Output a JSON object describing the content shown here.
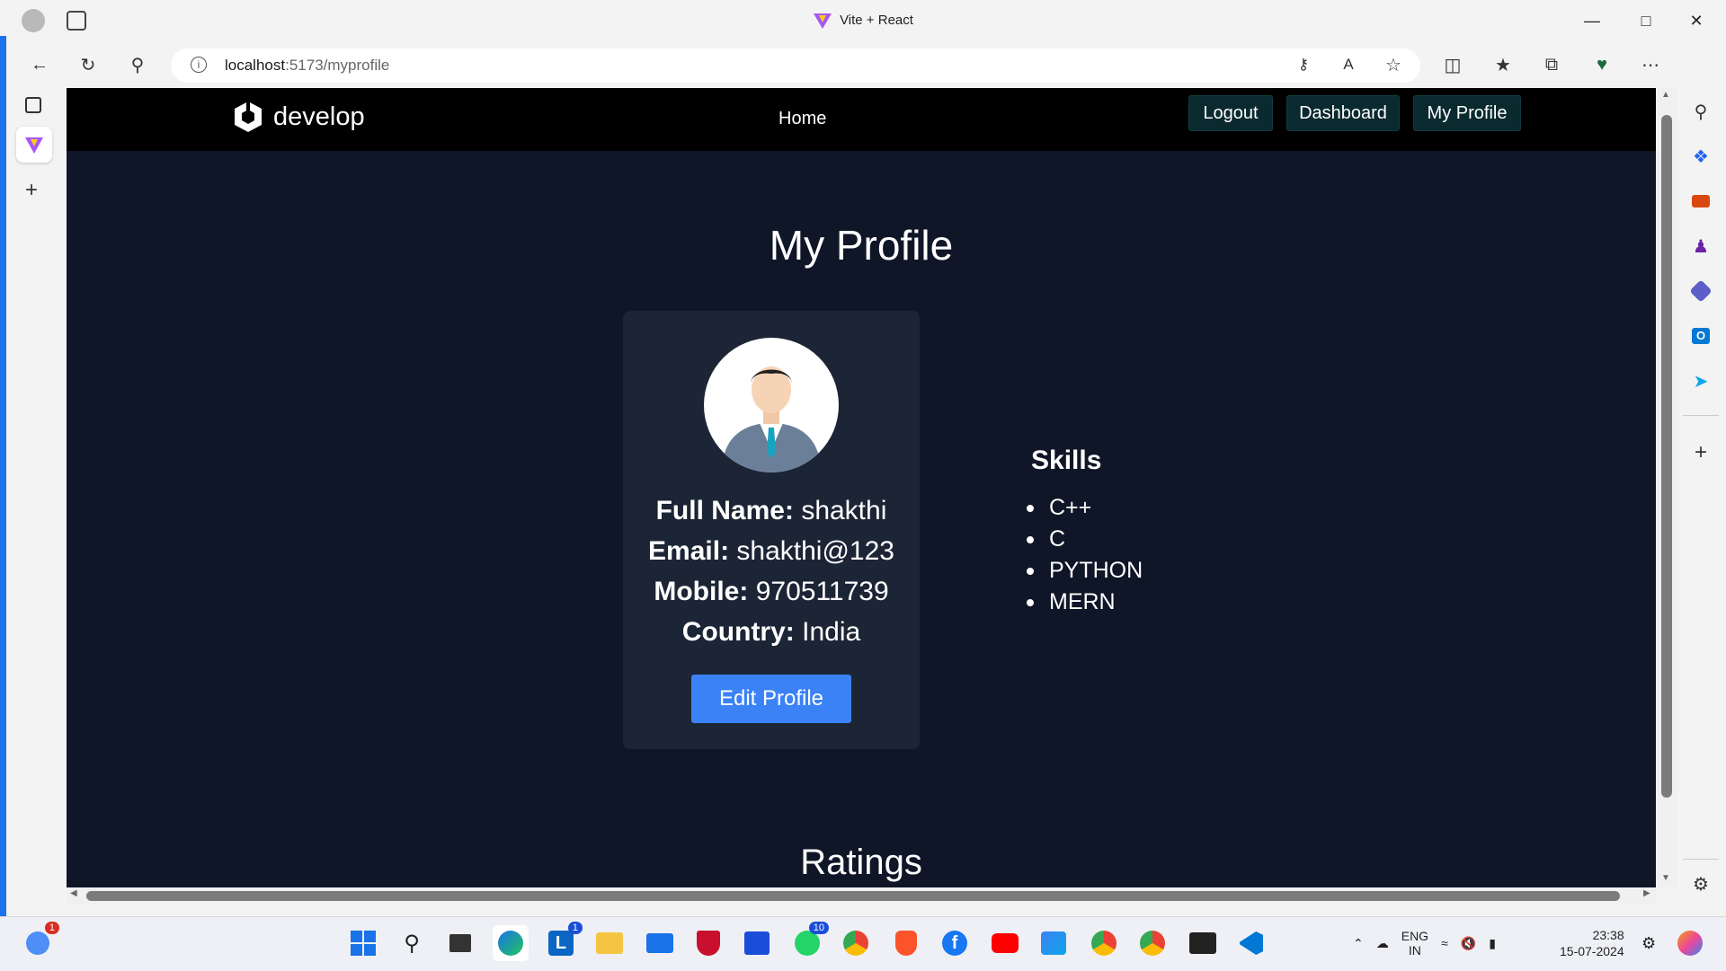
{
  "browser": {
    "tab_title": "Vite + React",
    "url_host": "localhost",
    "url_rest": ":5173/myprofile"
  },
  "nav": {
    "logo_text": "develop",
    "home": "Home",
    "logout": "Logout",
    "dashboard": "Dashboard",
    "my_profile": "My Profile"
  },
  "page": {
    "title": "My Profile",
    "ratings_title": "Ratings"
  },
  "profile": {
    "full_name_label": "Full Name:",
    "full_name": "shakthi",
    "email_label": "Email:",
    "email": "shakthi@123",
    "mobile_label": "Mobile:",
    "mobile": "970511739",
    "country_label": "Country:",
    "country": "India",
    "edit_button": "Edit Profile"
  },
  "skills": {
    "title": "Skills",
    "items": [
      "C++",
      "C",
      "PYTHON",
      "MERN"
    ]
  },
  "taskbar": {
    "notify_badge": "1",
    "linkedin_badge": "1",
    "whatsapp_badge": "10",
    "lang_line1": "ENG",
    "lang_line2": "IN",
    "time": "23:38",
    "date": "15-07-2024"
  },
  "colors": {
    "page_bg": "#0f1627",
    "card_bg": "#1c2535",
    "accent": "#3b82f6",
    "nav_btn": "#0a2a2f"
  }
}
